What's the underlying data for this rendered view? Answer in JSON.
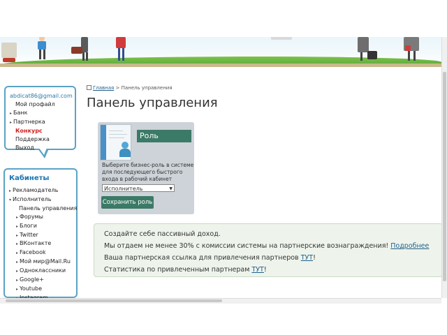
{
  "user": {
    "email": "abdicat86@gmail.com",
    "menu": [
      {
        "label": "Мой профайл",
        "type": "plain"
      },
      {
        "label": "Банк",
        "type": "arrow"
      },
      {
        "label": "Партнерка",
        "type": "arrow"
      },
      {
        "label": "Конкурс",
        "type": "red"
      },
      {
        "label": "Поддержка",
        "type": "plain"
      },
      {
        "label": "Выход",
        "type": "plain"
      }
    ]
  },
  "cabinets": {
    "title": "Кабинеты",
    "items": [
      {
        "label": "Рекламодатель",
        "level": 1
      },
      {
        "label": "Исполнитель",
        "level": 1
      },
      {
        "label": "Панель управления",
        "level": 2
      },
      {
        "label": "Форумы",
        "level": 3
      },
      {
        "label": "Блоги",
        "level": 3
      },
      {
        "label": "Twitter",
        "level": 3
      },
      {
        "label": "ВКонтакте",
        "level": 3
      },
      {
        "label": "Facebook",
        "level": 3
      },
      {
        "label": "Мой мир@Mail.Ru",
        "level": 3
      },
      {
        "label": "Одноклассники",
        "level": 3
      },
      {
        "label": "Google+",
        "level": 3
      },
      {
        "label": "Youtube",
        "level": 3
      },
      {
        "label": "Instagram",
        "level": 3
      }
    ]
  },
  "breadcrumb": {
    "home": "Главная",
    "separator": ">",
    "current": "Панель управления"
  },
  "page_title": "Панель управления",
  "role": {
    "title": "Роль",
    "description": "Выберите бизнес-роль в системе для последующего быстрого входа в рабочий кабинет",
    "selected": "Исполнитель",
    "save_label": "Сохранить роль"
  },
  "info": {
    "line1": "Создайте себе пассивный доход.",
    "line2_text": "Мы отдаем не менее 30% с комиссии системы на партнерские вознаграждения!",
    "line2_link": "Подробнее",
    "line3_text": "Ваша партнерская ссылка для привлечения партнеров",
    "line3_link": "ТУТ",
    "line4_text": "Статистика по привлеченным партнерам",
    "line4_link": "ТУТ"
  },
  "colors": {
    "accent": "#3b7a66",
    "frame": "#5aa3c4",
    "link": "#1f5f8b",
    "contest": "#d42020"
  }
}
